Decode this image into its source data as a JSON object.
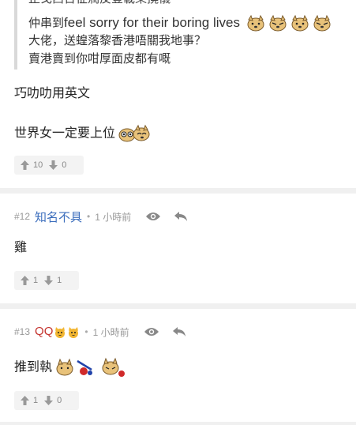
{
  "post_top": {
    "quote": {
      "cut_line": "止戈西台征潤反豈載樂撓儀",
      "line1_prefix": "仲串到",
      "line1_latin": "feel sorry for their boring lives",
      "line2": "大佬，送蝗落黎香港唔關我地事？",
      "line3": "賣港賣到你咁厚面皮都有嘅"
    },
    "text1": "巧叻叻用英文",
    "text2": "世界女一定要上位",
    "upvotes": "10",
    "downvotes": "0"
  },
  "comments": [
    {
      "number": "#12",
      "username": "知名不具",
      "dot": "•",
      "time": "1 小時前",
      "content": "雞",
      "upvotes": "1",
      "downvotes": "1"
    },
    {
      "number": "#13",
      "username": "QQ",
      "dot": "•",
      "time": "1 小時前",
      "content": "推到執",
      "upvotes": "1",
      "downvotes": "0"
    }
  ],
  "icons": {
    "up": "thumb-up-arrow-icon",
    "down": "thumb-down-arrow-icon",
    "eye": "eye-icon",
    "reply": "reply-icon",
    "emoji": "dog-emoji-icon",
    "cat": "cat-emoji-icon"
  },
  "colors": {
    "username_blue": "#3b6dbc",
    "username_red": "#c4322d",
    "meta_grey": "#999999",
    "divider": "#f0f0f0"
  }
}
